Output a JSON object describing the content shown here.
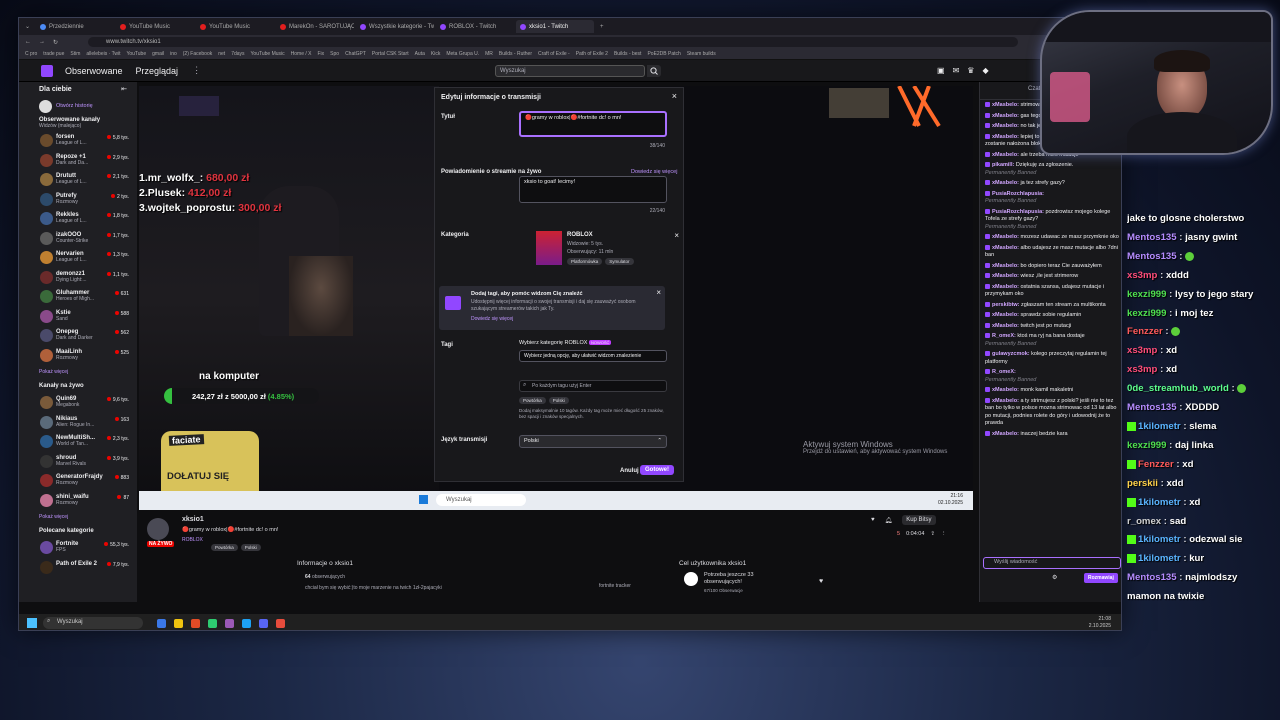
{
  "browser": {
    "tabs": [
      {
        "label": "Przedziennie",
        "color": "#4c8bf5"
      },
      {
        "label": "YouTube Music",
        "color": "#e21e1e"
      },
      {
        "label": "YouTube Music",
        "color": "#e21e1e"
      },
      {
        "label": "MarekOn - SAROTUJĄCY \\",
        "color": "#e21e1e"
      },
      {
        "label": "Wszystkie kategorie - Twit",
        "color": "#9147ff"
      },
      {
        "label": "ROBLOX - Twitch",
        "color": "#9147ff"
      },
      {
        "label": "xksio1 - Twitch",
        "color": "#9147ff"
      }
    ],
    "url": "www.twitch.tv/xksio1",
    "bookmarks": [
      "C pro",
      "trade pue",
      "Stim",
      "allelebeis · Twit",
      "YouTube",
      "gmail",
      "ino",
      "(2) Facebook",
      "net",
      "7days",
      "YouTube Music",
      "Home / X",
      "Fix",
      "Spo",
      "ChatGPT",
      "Portal CSK Start",
      "Auta",
      "Kick",
      "Meta Grupa U.",
      "MR",
      "Builds - Ruther",
      "Craft of Exile - ",
      "Path of Exile 2",
      "Builds - best",
      "PoE2DB Patch",
      "Steam builds"
    ]
  },
  "twitch": {
    "nav": {
      "following": "Obserwowane",
      "browse": "Przeglądaj",
      "search_placeholder": "Wyszukaj"
    },
    "sidebar": {
      "for_you": "Dla ciebie",
      "open_history": "Otwórz historię",
      "followed": "Obserwowane kanały",
      "followed_sub": "Widzów (malejąco)",
      "channels": [
        {
          "name": "forsen",
          "cat": "League of L...",
          "viewers": "5,8 tys.",
          "color": "#6a4b2c"
        },
        {
          "name": "Repoze +1",
          "cat": "Dark and Da...",
          "viewers": "2,9 tys.",
          "color": "#7a3a2b"
        },
        {
          "name": "Drututt",
          "cat": "League of L...",
          "viewers": "2,1 tys.",
          "color": "#8a6a3b"
        },
        {
          "name": "Putrefy",
          "cat": "Rozmowy",
          "viewers": "2 tys.",
          "color": "#2c4a6a"
        },
        {
          "name": "Rekkles",
          "cat": "League of L...",
          "viewers": "1,8 tys.",
          "color": "#3b5a8a"
        },
        {
          "name": "izakOOO",
          "cat": "Counter-Strike",
          "viewers": "1,7 tys.",
          "color": "#5a5a5a"
        },
        {
          "name": "Nervarien",
          "cat": "League of L...",
          "viewers": "1,3 tys.",
          "color": "#c08030"
        },
        {
          "name": "demonzz1",
          "cat": "Dying Light:...",
          "viewers": "1,1 tys.",
          "color": "#6a2a2a"
        },
        {
          "name": "Gluhammer",
          "cat": "Heroes of Migh...",
          "viewers": "631",
          "color": "#3a6a3a"
        },
        {
          "name": "Kstie",
          "cat": "Sand",
          "viewers": "588",
          "color": "#8a4a8a"
        },
        {
          "name": "Onepeg",
          "cat": "Dark and Darker",
          "viewers": "562",
          "color": "#4a4a6a"
        },
        {
          "name": "MaaiLinh",
          "cat": "Rozmowy",
          "viewers": "525",
          "color": "#b0603a"
        }
      ],
      "show_more": "Pokaż więcej",
      "live_header": "Kanały na żywo",
      "live": [
        {
          "name": "Quin69",
          "cat": "Megabonk",
          "viewers": "9,6 tys.",
          "color": "#7a5a3a"
        },
        {
          "name": "Nikiaus",
          "cat": "Alien: Rogue In...",
          "viewers": "163",
          "color": "#5a6a7a"
        },
        {
          "name": "NewMultiSh...",
          "cat": "World of Tan...",
          "viewers": "2,3 tys.",
          "color": "#2a5a8a"
        },
        {
          "name": "shroud",
          "cat": "Marvel Rivals",
          "viewers": "3,9 tys.",
          "color": "#333"
        },
        {
          "name": "GeneratorFrajdy",
          "cat": "Rozmowy",
          "viewers": "883",
          "color": "#8a2a2a"
        },
        {
          "name": "shini_waifu",
          "cat": "Rozmowy",
          "viewers": "87",
          "color": "#c07090"
        }
      ],
      "live_more": "Pokaż więcej",
      "rec_header": "Polecane kategorie",
      "rec": [
        {
          "name": "Fortnite",
          "cat": "FPS",
          "viewers": "55,3 tys.",
          "color": "#6a4aa0"
        },
        {
          "name": "Path of Exile 2",
          "cat": "",
          "viewers": "7,9 tys.",
          "color": "#3a2a1a"
        }
      ]
    },
    "overlay": {
      "donors": [
        "1.mr_wolfx_: 680,00 zł",
        "2.Plusek: 412,00 zł",
        "3.wojtek_poprostu: 300,00 zł"
      ],
      "donors_names": [
        "1.mr_wolfx_:",
        "2.Plusek:",
        "3.wojtek_poprostu:"
      ],
      "donors_values": [
        "680,00 zł",
        "412,00 zł",
        "300,00 zł"
      ],
      "computer_label": "na komputer",
      "goal_text": "242,27 zł z 5000,00 zł",
      "goal_pct": "(4.85%)",
      "goal_fraction": 0.0485,
      "donate_brand": "faciate",
      "donate_label": "DOŁATUJ SIĘ"
    },
    "modal": {
      "title": "Edytuj informacje o transmisji",
      "title_label": "Tytuł",
      "title_value": "🔴gramy w roblox|🔴#fortnite dc! o mn!",
      "title_count": "38/140",
      "notif_label": "Powiadomienie o streamie na żywo",
      "notif_link": "Dowiedz się więcej",
      "notif_value": "xksio to goat! lecimy!",
      "notif_count": "22/140",
      "category_label": "Kategoria",
      "category_name": "ROBLOX",
      "category_viewers": "Widzowie: 5 tys.",
      "category_watch": "Obserwujący: 11 mln",
      "category_tags": [
        "Platformówka",
        "Symulator"
      ],
      "promo_title": "Dodaj tagi, aby pomóc widzom Cię znaleźć",
      "promo_text": "Udostępnij więcej informacji o swojej transmisji i daj się zauważyć osobom szukającym streamerów takich jak Ty.",
      "promo_link": "Dowiedz się więcej",
      "tags_label": "Tagi",
      "tags_recommend": "Wybierz kategorię ROBLOX",
      "tags_new": "NOWOŚĆ",
      "tags_select": "Wybierz jedną opcję, aby ułatwić widzom znalezienie",
      "tags_search": "Po każdym tagu użyj Enter",
      "tags": [
        "Powtórka",
        "Polski"
      ],
      "tags_help": "Dodaj maksymalnie 10 tagów. Każdy tag może mieć długość 25 znaków, bez spacji i znaków specjalnych.",
      "lang_label": "Język transmisji",
      "lang_value": "Polski",
      "cancel": "Anuluj",
      "done": "Gotowe!"
    },
    "watermark": {
      "title": "Aktywuj system Windows",
      "sub": "Przejdź do ustawień, aby aktywować system Windows"
    },
    "inner_taskbar": {
      "search": "Wyszukaj",
      "time": "21:16",
      "date": "02.10.2025"
    },
    "stream_info": {
      "name": "xksio1",
      "title": "🔴gramy w roblox|🔴#fortnite dc! o mn!",
      "live": "NA ŻYWO",
      "category": "ROBLOX",
      "tags": [
        "Powtórka",
        "Polski"
      ],
      "viewers": "5",
      "uptime": "0:04:04",
      "sub_label": "Kup Bitsy"
    },
    "about": {
      "header": "Informacje o xksio1",
      "followers_count": "64",
      "followers_label": "obserwujących",
      "bio": "chciał bym się wybić:)to moje marzenie na twich 1zł-2pajacyki",
      "link": "fortnite tracker"
    },
    "goal": {
      "header": "Cel użytkownika xksio1",
      "text": "Potrzeba jeszcze 33 obserwujących!",
      "sub": "67/100 Obserwacje"
    },
    "chat": {
      "header": "Czat",
      "messages": [
        {
          "user": "xMasbelo:",
          "text": "strimowa",
          "banned": false
        },
        {
          "user": "xMasbelo:",
          "text": "gas tego str",
          "banned": false
        },
        {
          "user": "xMasbelo:",
          "text": "no tak jest",
          "banned": false
        },
        {
          "user": "xMasbelo:",
          "text": "lepiej to zgas albo na nego konto zostanie nałożona blokada",
          "banned": false
        },
        {
          "user": "xMasbelo:",
          "text": "ale trzeba mieć mutacje",
          "banned": false
        },
        {
          "user": "pikamilI:",
          "text": "Dziękuję za zgłoszenie.",
          "banned": true
        },
        {
          "user": "xMasbelo:",
          "text": "ja tez strefy gazy?",
          "banned": false
        },
        {
          "user": "PusiaRozchlapusia:",
          "text": "",
          "banned": true
        },
        {
          "user": "PusiaRozchlapusia:",
          "text": "pozdrowisz mojego kolege Tofela ze strefy gazy?",
          "banned": true
        },
        {
          "user": "xMasbelo:",
          "text": "mozesz udawac ze masz przymknie oko",
          "banned": false
        },
        {
          "user": "xMasbelo:",
          "text": "albo udajesz ze masz mutacje albo 7dni ban",
          "banned": false
        },
        {
          "user": "xMasbelo:",
          "text": "bo dopiero teraz Cie zauważyłem",
          "banned": false
        },
        {
          "user": "xMasbelo:",
          "text": "wiesz ,ile jest strimerow",
          "banned": false
        },
        {
          "user": "xMasbelo:",
          "text": "ostatnia szansa, udajesz mutacje i przymykam oko",
          "banned": false
        },
        {
          "user": "perskibtw:",
          "text": "zgłaszam ten stream za multikonta",
          "banned": false
        },
        {
          "user": "xMasbelo:",
          "text": "sprawdz sobie regulamin",
          "banned": false
        },
        {
          "user": "xMasbelo:",
          "text": "twitch jest po mutacji",
          "banned": false
        },
        {
          "user": "R_omeX:",
          "text": "ktoś ma ryj na bana dostaje",
          "banned": true
        },
        {
          "user": "gulawyzcmok:",
          "text": "kolego przeczytaj regulamin tej platformy",
          "banned": false
        },
        {
          "user": "R_omeX:",
          "text": "",
          "banned": true
        },
        {
          "user": "xMasbelo:",
          "text": "monk kamil makaletni",
          "banned": false
        },
        {
          "user": "xMasbelo:",
          "text": "a ty strimujesz z polski? jeśli nie to tez ban bo tylko w polsce mozna strimowac od 13 lat albo po mutacji, podnies rolete do góry i udowodnij że to prawda",
          "banned": false
        },
        {
          "user": "xMasbelo:",
          "text": "inaczej bedzie kara",
          "banned": false
        }
      ],
      "banned_label": "Permanently Banned",
      "input_placeholder": "Wyślij wiadomość",
      "send": "Rozmawiaj"
    }
  },
  "windows": {
    "search": "Wyszukaj",
    "time": "21:08",
    "date": "2.10.2025"
  },
  "overlay_chat": [
    {
      "user": "",
      "text": "jake to glosne cholerstwo",
      "color": "#ffffff"
    },
    {
      "user": "Mentos135",
      "text": "jasny gwint",
      "color": "#b58cff"
    },
    {
      "user": "Mentos135",
      "text": "",
      "color": "#b58cff",
      "emote": true
    },
    {
      "user": "xs3mp",
      "text": "xddd",
      "color": "#ff4d7a"
    },
    {
      "user": "kexzi999",
      "text": "lysy to jego stary",
      "color": "#4fe04f"
    },
    {
      "user": "kexzi999",
      "text": "i moj tez",
      "color": "#4fe04f"
    },
    {
      "user": "Fenzzer",
      "text": "",
      "color": "#ff5a5a",
      "emote": true
    },
    {
      "user": "xs3mp",
      "text": "xd",
      "color": "#ff4d7a"
    },
    {
      "user": "xs3mp",
      "text": "xd",
      "color": "#ff4d7a"
    },
    {
      "user": "0de_streamhub_world",
      "text": "",
      "color": "#5dff8f",
      "emote": true
    },
    {
      "user": "Mentos135",
      "text": "XDDDD",
      "color": "#b58cff"
    },
    {
      "user": "1kilometr",
      "text": "slema",
      "color": "#5ab4ff",
      "kick": true
    },
    {
      "user": "kexzi999",
      "text": "daj linka",
      "color": "#4fe04f"
    },
    {
      "user": "Fenzzer",
      "text": "xd",
      "color": "#ff5a5a",
      "kick": true
    },
    {
      "user": "perskii",
      "text": "xdd",
      "color": "#ffd24a"
    },
    {
      "user": "1kilometr",
      "text": "xd",
      "color": "#5ab4ff",
      "kick": true
    },
    {
      "user": "r_omex",
      "text": "sad",
      "color": "#d0d0d0"
    },
    {
      "user": "1kilometr",
      "text": "odezwal sie",
      "color": "#5ab4ff",
      "kick": true
    },
    {
      "user": "1kilometr",
      "text": "kur",
      "color": "#5ab4ff",
      "kick": true
    },
    {
      "user": "Mentos135",
      "text": "najmlodszy",
      "color": "#b58cff"
    },
    {
      "user": "",
      "text": "mamon na twixie",
      "color": "#ffffff"
    }
  ]
}
